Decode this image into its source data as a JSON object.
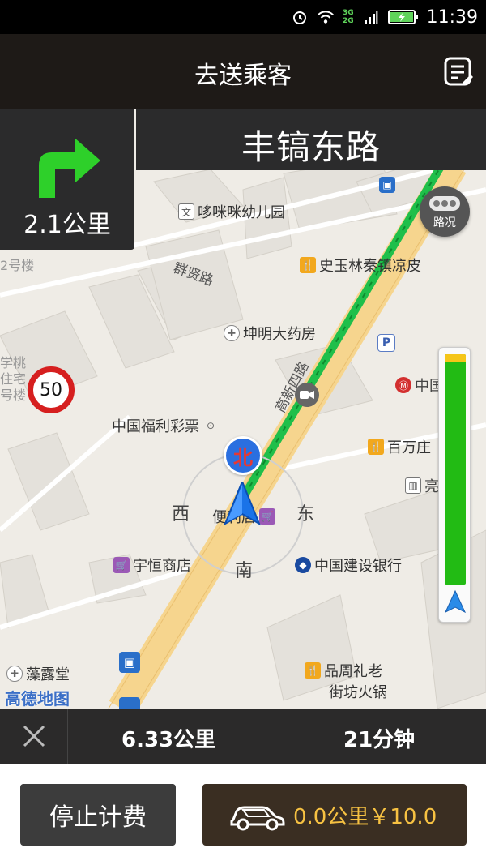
{
  "status_bar": {
    "time": "11:39",
    "network_3g": "3G",
    "network_2g": "2G"
  },
  "header": {
    "title": "去送乘客",
    "note_icon": "note-list-icon"
  },
  "navigation": {
    "street_name": "丰镐东路",
    "turn": {
      "direction": "right",
      "distance": "2.1公里",
      "icon": "turn-right-arrow-icon"
    },
    "traffic_button_label": "路况",
    "speed_limit": "50",
    "compass": {
      "north": "北",
      "south": "南",
      "east": "东",
      "west": "西"
    }
  },
  "map": {
    "pois": [
      {
        "label": "哆咪咪幼儿园",
        "icon": "kindergarten-icon"
      },
      {
        "label": "史玉林秦镇凉皮",
        "icon": "restaurant-icon"
      },
      {
        "label": "坤明大药房",
        "icon": "pharmacy-icon"
      },
      {
        "label": "中国福利彩票",
        "icon": "lottery-icon"
      },
      {
        "label": "百万庄",
        "icon": "restaurant-icon"
      },
      {
        "label": "便利店",
        "icon": "shop-icon"
      },
      {
        "label": "宇恒商店",
        "icon": "shop-icon"
      },
      {
        "label": "中国建设银行",
        "icon": "bank-icon"
      },
      {
        "label": "藻露堂",
        "icon": "pharmacy-icon"
      },
      {
        "label": "品周礼老",
        "icon": "restaurant-icon"
      },
      {
        "label": "街坊火锅",
        "icon": ""
      }
    ],
    "roads": [
      "群贤路",
      "高新四路"
    ],
    "partial_labels": [
      "中国",
      "学桃",
      "住宅",
      "号楼",
      "亮",
      "街",
      "2号楼"
    ],
    "logo": "高德地图",
    "colors": {
      "route": "#1fbf4a",
      "road": "#f6d58e",
      "building": "#e3e0da"
    }
  },
  "route_progress": {
    "remaining_fraction": 0.97
  },
  "trip_info": {
    "distance": "6.33公里",
    "duration": "21分钟"
  },
  "actions": {
    "stop_label": "停止计费",
    "fare_label": "0.0公里￥10.0"
  }
}
